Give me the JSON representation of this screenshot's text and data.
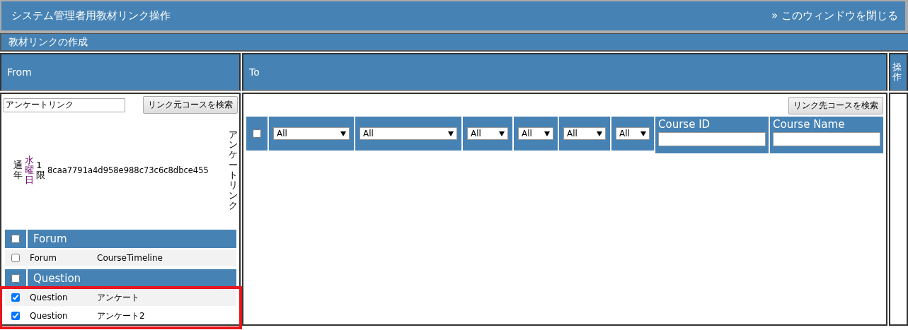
{
  "header": {
    "title": "システム管理者用教材リンク操作",
    "close_link": "» このウィンドウを閉じる"
  },
  "section_title": "教材リンクの作成",
  "columns": {
    "from": "From",
    "to": "To",
    "actions": "操作"
  },
  "from": {
    "search_value": "アンケートリンク",
    "search_button": "リンク元コースを検索",
    "course": {
      "term": "通年",
      "day": "水曜日",
      "period": "1限",
      "id": "8caa7791a4d958e988c73c6c8dbce455",
      "name": "アンケートリンク"
    },
    "groups": [
      {
        "title": "Forum",
        "checked": false,
        "highlighted": false,
        "items": [
          {
            "type": "Forum",
            "name": "CourseTimeline",
            "checked": false
          }
        ]
      },
      {
        "title": "Question",
        "checked": false,
        "highlighted": true,
        "items": [
          {
            "type": "Question",
            "name": "アンケート",
            "checked": true
          },
          {
            "type": "Question",
            "name": "アンケート2",
            "checked": true
          }
        ]
      }
    ]
  },
  "to": {
    "search_button": "リンク先コースを検索",
    "select_all_checked": false,
    "filters": [
      {
        "value": "All"
      },
      {
        "value": "All"
      },
      {
        "value": "All"
      },
      {
        "value": "All"
      },
      {
        "value": "All"
      },
      {
        "value": "All"
      }
    ],
    "course_id_label": "Course ID",
    "course_name_label": "Course Name"
  }
}
